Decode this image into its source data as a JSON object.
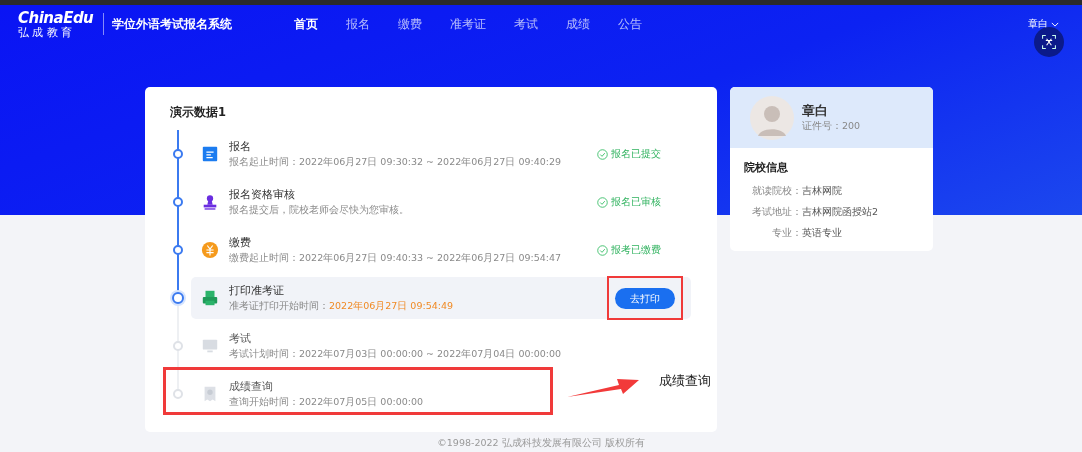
{
  "header": {
    "logo": {
      "wordmark": "ChinaEdu",
      "tagline": "弘 成 教 育"
    },
    "site_title": "学位外语考试报名系统",
    "nav": [
      {
        "label": "首页",
        "selected": true
      },
      {
        "label": "报名",
        "selected": false
      },
      {
        "label": "缴费",
        "selected": false
      },
      {
        "label": "准考证",
        "selected": false
      },
      {
        "label": "考试",
        "selected": false
      },
      {
        "label": "成绩",
        "selected": false
      },
      {
        "label": "公告",
        "selected": false
      }
    ],
    "user": {
      "name": "章白"
    }
  },
  "progress": {
    "title": "演示数据1",
    "steps": [
      {
        "kind": "document",
        "done": true,
        "current": false,
        "boxed": false,
        "title": "报名",
        "detail_label": "报名起止时间：",
        "detail": "2022年06月27日 09:30:32 ~ 2022年06月27日 09:40:29",
        "status": "报名已提交"
      },
      {
        "kind": "stamp",
        "done": true,
        "current": false,
        "boxed": false,
        "title": "报名资格审核",
        "detail": "报名提交后，院校老师会尽快为您审核。",
        "status": "报名已审核"
      },
      {
        "kind": "coin",
        "done": true,
        "current": false,
        "boxed": false,
        "title": "缴费",
        "detail_label": "缴费起止时间：",
        "detail": "2022年06月27日 09:40:33 ~ 2022年06月27日 09:54:47",
        "status": "报考已缴费"
      },
      {
        "kind": "printer",
        "done": false,
        "current": true,
        "boxed": false,
        "title": "打印准考证",
        "detail_label": "准考证打印开始时间：",
        "detail": "2022年06月27日 09:54:49",
        "action": {
          "label": "去打印",
          "boxed": true
        }
      },
      {
        "kind": "monitor",
        "done": false,
        "current": false,
        "boxed": false,
        "title": "考试",
        "detail_label": "考试计划时间：",
        "detail": "2022年07月03日 00:00:00 ~ 2022年07月04日 00:00:00"
      },
      {
        "kind": "certificate",
        "done": false,
        "current": false,
        "boxed": true,
        "title": "成绩查询",
        "detail_label": "查询开始时间：",
        "detail": "2022年07月05日 00:00:00"
      }
    ]
  },
  "callout": {
    "text": "成绩查询"
  },
  "profile": {
    "name": "章白",
    "id_label": "证件号：",
    "id": "200",
    "section_title": "院校信息",
    "fields": [
      {
        "label": "就读院校：",
        "value": "吉林网院"
      },
      {
        "label": "考试地址：",
        "value": "吉林网院函授站2"
      },
      {
        "label": "专业：",
        "value": "英语专业"
      }
    ]
  },
  "footer": "©1998-2022 弘成科技发展有限公司 版权所有"
}
